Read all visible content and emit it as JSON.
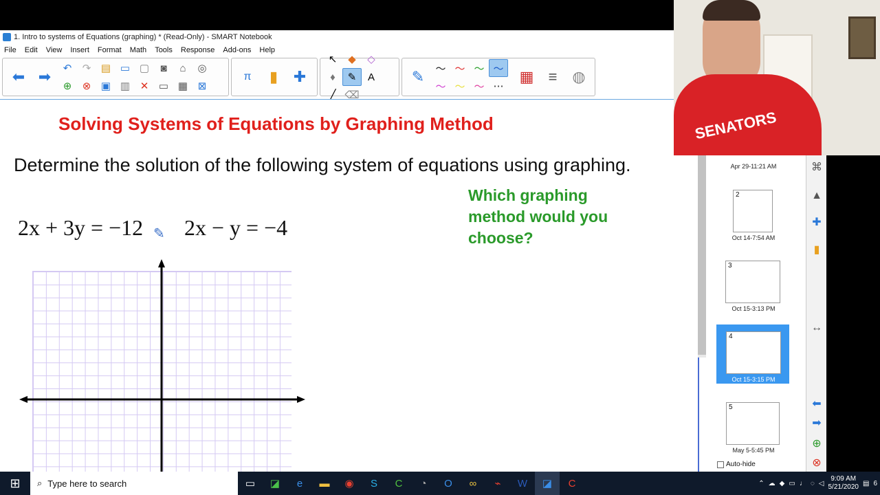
{
  "window": {
    "title": "1. Intro to systems of Equations (graphing) * (Read-Only) - SMART Notebook"
  },
  "menu": [
    "File",
    "Edit",
    "View",
    "Insert",
    "Format",
    "Math",
    "Tools",
    "Response",
    "Add-ons",
    "Help"
  ],
  "canvas": {
    "title": "Solving Systems of Equations by Graphing Method",
    "prompt": "Determine the solution of the following system of equations using graphing.",
    "equation1": "2x + 3y = −12",
    "equation2": "2x − y = −4",
    "question": "Which graphing method would you choose?"
  },
  "sorter": {
    "pages": [
      {
        "num": "",
        "label": "Apr 29-11:21 AM"
      },
      {
        "num": "2",
        "label": "Oct 14-7:54 AM"
      },
      {
        "num": "3",
        "label": "Oct 15-3:13 PM"
      },
      {
        "num": "4",
        "label": "Oct 15-3:15 PM",
        "selected": true
      },
      {
        "num": "5",
        "label": "May 5-5:45 PM"
      }
    ],
    "autohide": "Auto-hide"
  },
  "webcam": {
    "shirt_text": "SENATORS"
  },
  "taskbar": {
    "search_placeholder": "Type here to search",
    "time": "9:09 AM",
    "date": "5/21/2020",
    "notification_count": "6"
  },
  "colors": {
    "title_red": "#e0201c",
    "question_green": "#2a9a2a",
    "grid_purple": "#d4c9f3",
    "selected_blue": "#3a98f0"
  }
}
